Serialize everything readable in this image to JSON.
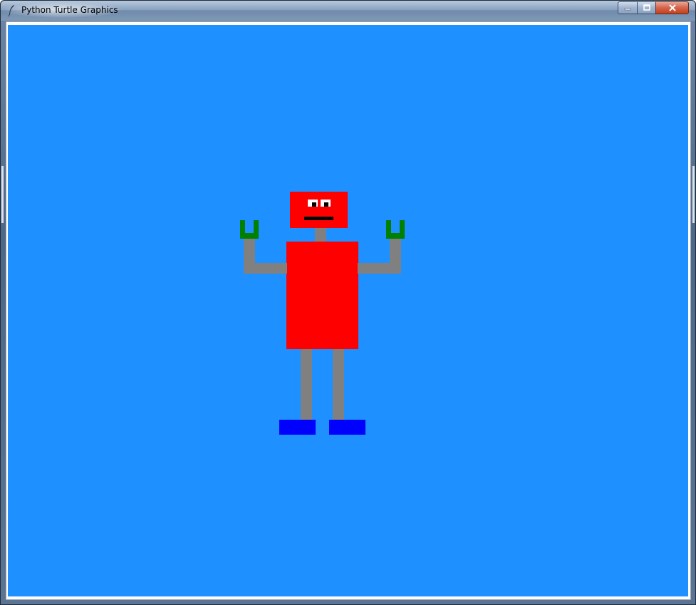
{
  "window": {
    "title": "Python Turtle Graphics",
    "icon": "feather-quill-icon",
    "controls": {
      "minimize_icon": "minimize-icon",
      "maximize_icon": "maximize-icon",
      "close_icon": "close-icon"
    }
  },
  "canvas": {
    "background_color": "#1e90ff",
    "robot": {
      "head_color": "#ff0000",
      "eye_color": "#ffffff",
      "pupil_color": "#000000",
      "mouth_color": "#000000",
      "neck_color": "#808080",
      "body_color": "#ff0000",
      "arm_color": "#808080",
      "hand_color": "#008000",
      "leg_color": "#808080",
      "foot_color": "#0000ff"
    }
  }
}
